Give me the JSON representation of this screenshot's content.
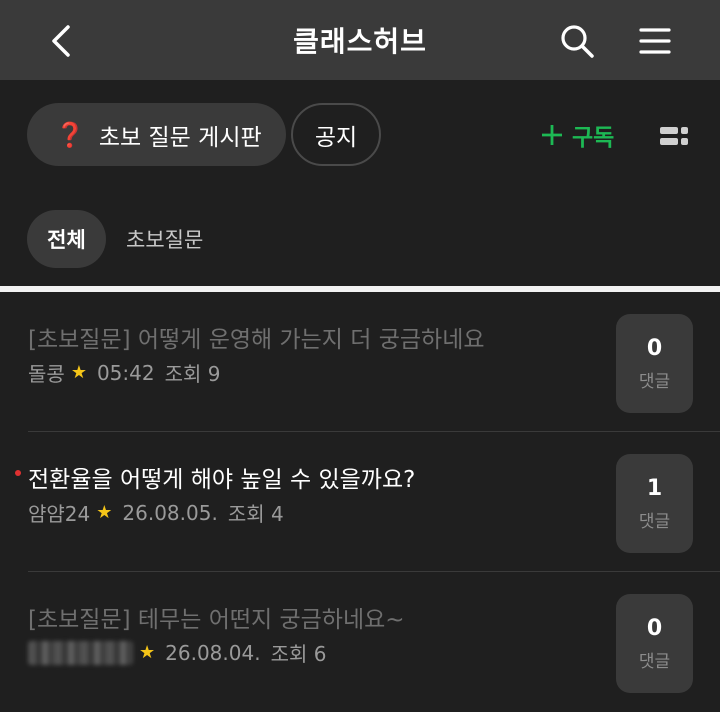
{
  "header": {
    "title": "클래스허브",
    "back_icon": "chevron-left-icon",
    "search_icon": "search-icon",
    "menu_icon": "hamburger-menu-icon"
  },
  "board": {
    "chip_icon": "❓",
    "chip_label": "초보 질문 게시판",
    "notice_label": "공지",
    "subscribe_label": "구독",
    "subscribe_color": "#1db954"
  },
  "filters": {
    "all_label": "전체",
    "beginner_label": "초보질문"
  },
  "posts": [
    {
      "title": "[초보질문] 어떻게  운영해 가는지 더 궁금하네요",
      "author": "돌콩",
      "star": "★",
      "time": "05:42",
      "views": "조회 9",
      "comments": "0",
      "comment_label": "댓글",
      "read": true
    },
    {
      "title": "전환율을 어떻게 해야 높일 수 있을까요?",
      "author": "얌얌24",
      "star": "★",
      "time": "26.08.05.",
      "views": "조회 4",
      "comments": "1",
      "comment_label": "댓글",
      "read": false
    },
    {
      "title": "[초보질문] 테무는 어떤지 궁금하네요~",
      "author": "",
      "star": "★",
      "time": "26.08.04.",
      "views": "조회 6",
      "comments": "0",
      "comment_label": "댓글",
      "read": true
    }
  ],
  "colors": {
    "unread_dot": "#e03131",
    "star": "#f5c518"
  }
}
